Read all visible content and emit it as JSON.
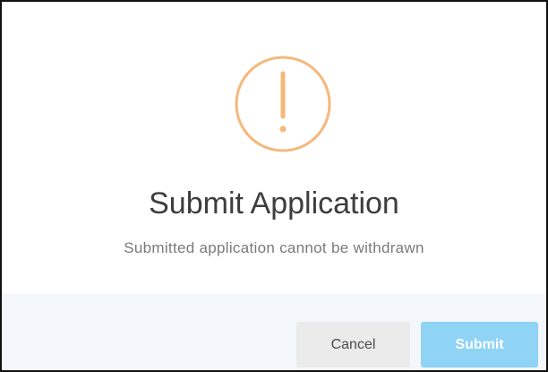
{
  "dialog": {
    "icon": "exclamation-circle-icon",
    "icon_color": "#f5b87a",
    "title": "Submit Application",
    "message": "Submitted application cannot be withdrawn"
  },
  "footer": {
    "cancel_label": "Cancel",
    "submit_label": "Submit"
  },
  "colors": {
    "footer_bg": "#f3f7fb",
    "cancel_bg": "#ebebeb",
    "submit_bg": "#8fd3f5"
  }
}
